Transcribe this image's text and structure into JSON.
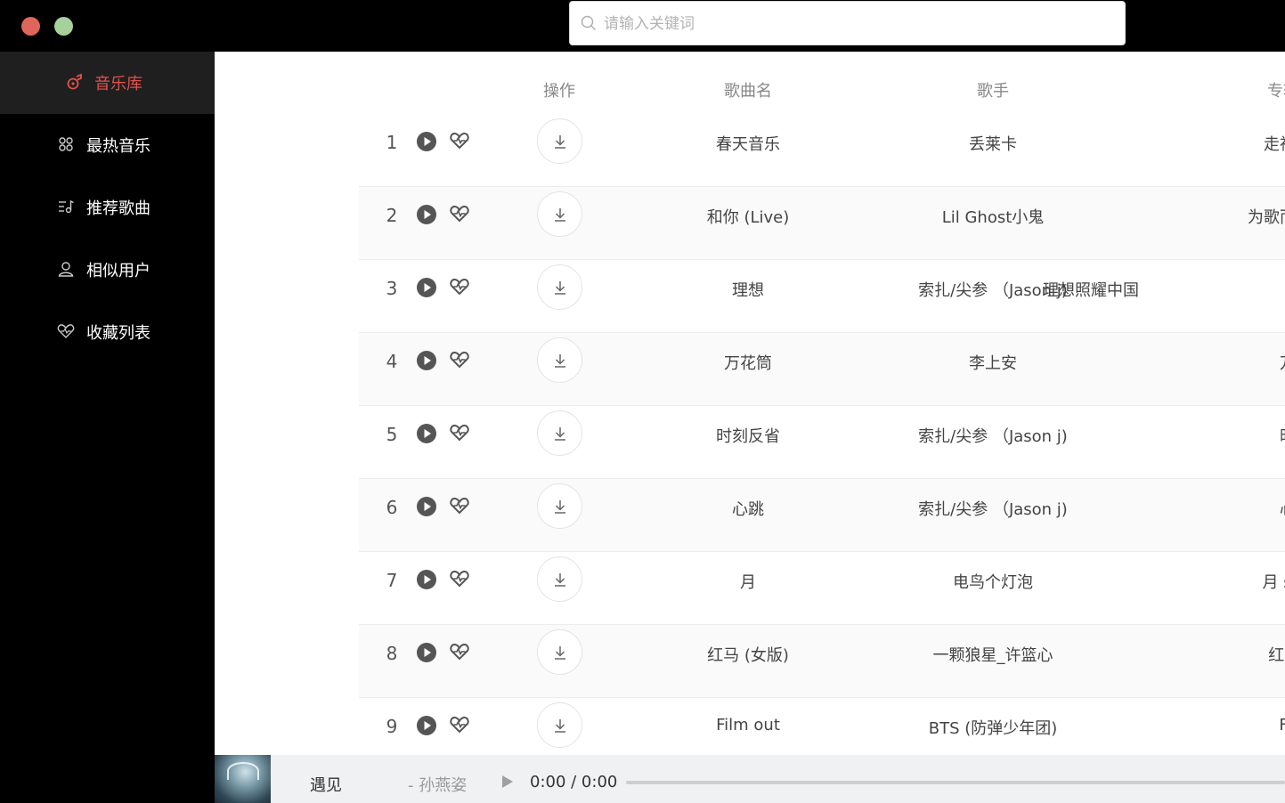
{
  "search": {
    "placeholder": "请输入关键词"
  },
  "sidebar": {
    "items": [
      {
        "label": "音乐库",
        "icon": "music-library-icon",
        "active": true
      },
      {
        "label": "最热音乐",
        "icon": "hot-music-icon",
        "active": false
      },
      {
        "label": "推荐歌曲",
        "icon": "recommend-icon",
        "active": false
      },
      {
        "label": "相似用户",
        "icon": "user-icon",
        "active": false
      },
      {
        "label": "收藏列表",
        "icon": "heart-icon",
        "active": false
      }
    ]
  },
  "table": {
    "headers": {
      "action": "操作",
      "name": "歌曲名",
      "artist": "歌手",
      "album": "专辑"
    },
    "rows": [
      {
        "index": "1",
        "name": "春天音乐",
        "artist": "丢莱卡",
        "album": "走神的"
      },
      {
        "index": "2",
        "name": "和你 (Live)",
        "artist": "Lil Ghost小鬼",
        "album": "为歌而赞"
      },
      {
        "index": "3",
        "name": "理想",
        "artist": "索扎/尖参 （Jason j)",
        "album": "理想照耀中国"
      },
      {
        "index": "4",
        "name": "万花筒",
        "artist": "李上安",
        "album": "万花"
      },
      {
        "index": "5",
        "name": "时刻反省",
        "artist": "索扎/尖参 （Jason j)",
        "album": "时刻"
      },
      {
        "index": "6",
        "name": "心跳",
        "artist": "索扎/尖参 （Jason j)",
        "album": "心跳"
      },
      {
        "index": "7",
        "name": "月",
        "artist": "电鸟个灯泡",
        "album": "月 sho"
      },
      {
        "index": "8",
        "name": "红马 (女版)",
        "artist": "一颗狼星_许篮心",
        "album": "红马 ("
      },
      {
        "index": "9",
        "name": "Film out",
        "artist": "BTS (防弹少年团)",
        "album": "Film"
      }
    ]
  },
  "player": {
    "title": "遇见",
    "artist": "- 孙燕姿",
    "time": "0:00 / 0:00",
    "progress": 0
  },
  "colors": {
    "accent": "#e0524d",
    "sidebar_bg": "#000000",
    "active_bg": "#1f1f1f",
    "close_dot": "#e0655a",
    "max_dot": "#a7d19a"
  }
}
